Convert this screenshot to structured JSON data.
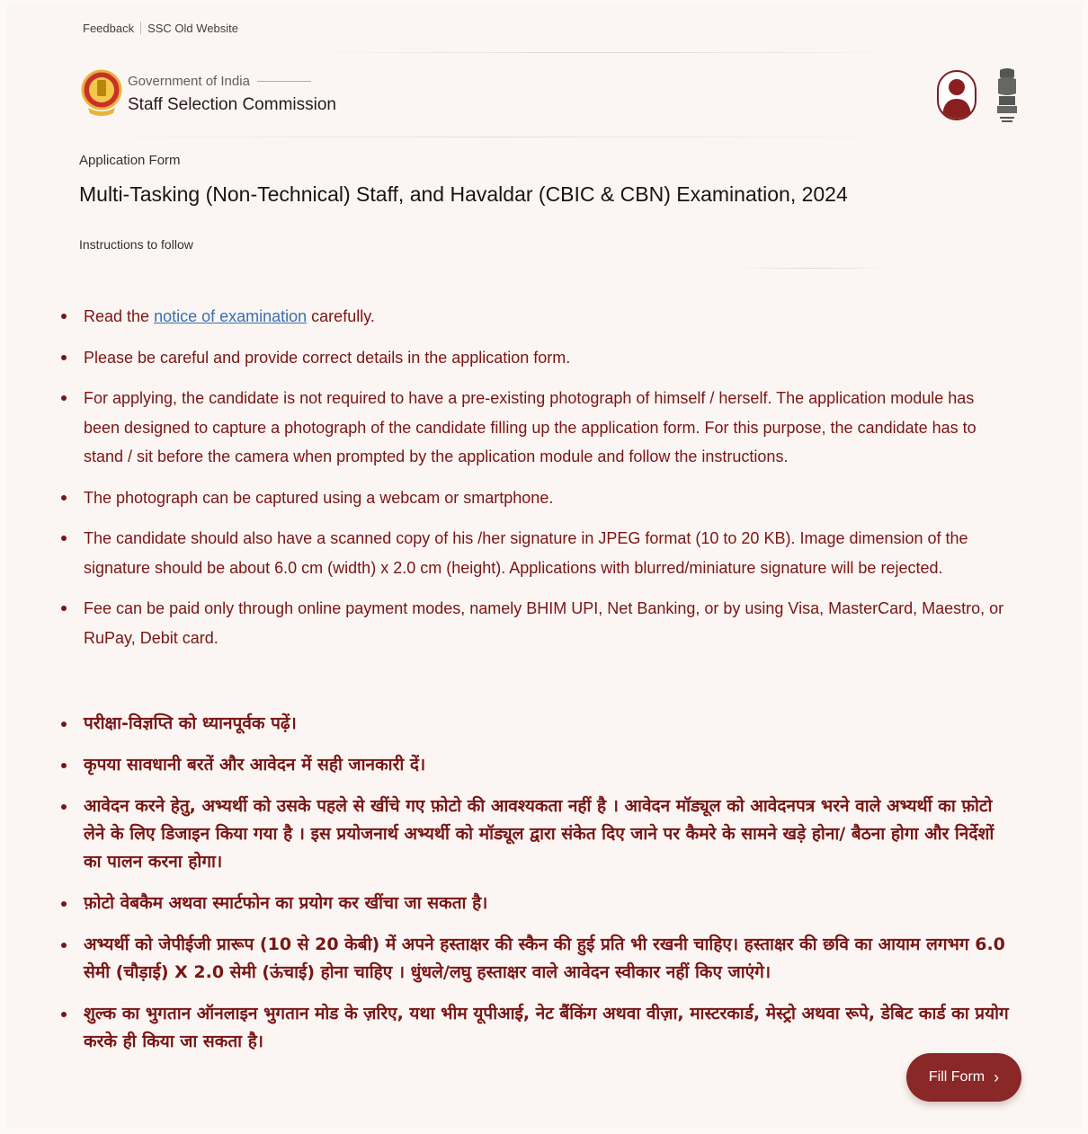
{
  "top_links": {
    "feedback": "Feedback",
    "old_site": "SSC Old Website"
  },
  "brand": {
    "government": "Government of India",
    "organization": "Staff Selection Commission"
  },
  "form": {
    "label": "Application Form",
    "title": "Multi-Tasking (Non-Technical) Staff, and Havaldar (CBIC & CBN) Examination, 2024",
    "instructions_label": "Instructions to follow"
  },
  "instructions_en": [
    {
      "before": "Read the ",
      "link": "notice of examination",
      "after": " carefully."
    },
    {
      "text": "Please be careful and provide correct details in the application form."
    },
    {
      "text": "For applying, the candidate is not required to have a pre-existing photograph of himself / herself. The application module has been designed to capture a photograph of the candidate filling up the application form. For this purpose, the candidate has to stand / sit before the camera when prompted by the application module and follow the instructions."
    },
    {
      "text": "The photograph can be captured using a webcam or smartphone."
    },
    {
      "text": "The candidate should also have a scanned copy of his /her signature in JPEG format (10 to 20 KB). Image dimension of the signature should be about 6.0 cm (width) x 2.0 cm (height). Applications with blurred/miniature signature will be rejected."
    },
    {
      "text": "Fee can be paid only through online payment modes, namely BHIM UPI, Net Banking, or by using Visa, MasterCard, Maestro, or RuPay, Debit card."
    }
  ],
  "instructions_hi": [
    "परीक्षा-विज्ञप्ति को ध्यानपूर्वक पढ़ें।",
    "कृपया सावधानी बरतें और आवेदन में सही जानकारी दें।",
    "आवेदन करने हेतु, अभ्यर्थी को उसके पहले से खींचे गए फ़ोटो की आवश्यकता नहीं है । आवेदन मॉड्यूल को आवेदनपत्र भरने वाले अभ्यर्थी का फ़ोटो लेने के लिए डिजाइन किया गया है । इस प्रयोजनार्थ अभ्यर्थी को मॉड्यूल द्वारा संकेत दिए जाने पर कैमरे के सामने खड़े होना/ बैठना होगा और निर्देशों का पालन करना होगा।",
    "फ़ोटो वेबकैम अथवा स्मार्टफोन का प्रयोग कर खींचा जा सकता है।",
    "अभ्यर्थी को जेपीईजी प्रारूप (10 से 20 केबी) में अपने हस्ताक्षर की स्कैन की हुई प्रति भी रखनी चाहिए। हस्ताक्षर की छवि का आयाम लगभग 6.0 सेमी (चौड़ाई) X 2.0 सेमी (ऊंचाई) होना चाहिए । धुंधले/लघु हस्ताक्षर वाले आवेदन स्वीकार नहीं किए जाएंगे।",
    "शुल्क का भुगतान ऑनलाइन भुगतान मोड के ज़रिए, यथा भीम यूपीआई, नेट बैंकिंग अथवा वीज़ा, मास्टरकार्ड, मेस्ट्रो अथवा रूपे, डेबिट कार्ड का प्रयोग करके ही किया जा सकता है।"
  ],
  "actions": {
    "fill_form": "Fill Form"
  },
  "icons": {
    "emblem": "ssc-emblem-icon",
    "user": "user-avatar-icon",
    "national_emblem": "ashoka-emblem-icon",
    "chevron": "chevron-right-icon"
  },
  "colors": {
    "accent": "#8a2727",
    "text_instruction": "#7a1515",
    "link": "#3a6fb0",
    "background": "#fbf6f3"
  }
}
